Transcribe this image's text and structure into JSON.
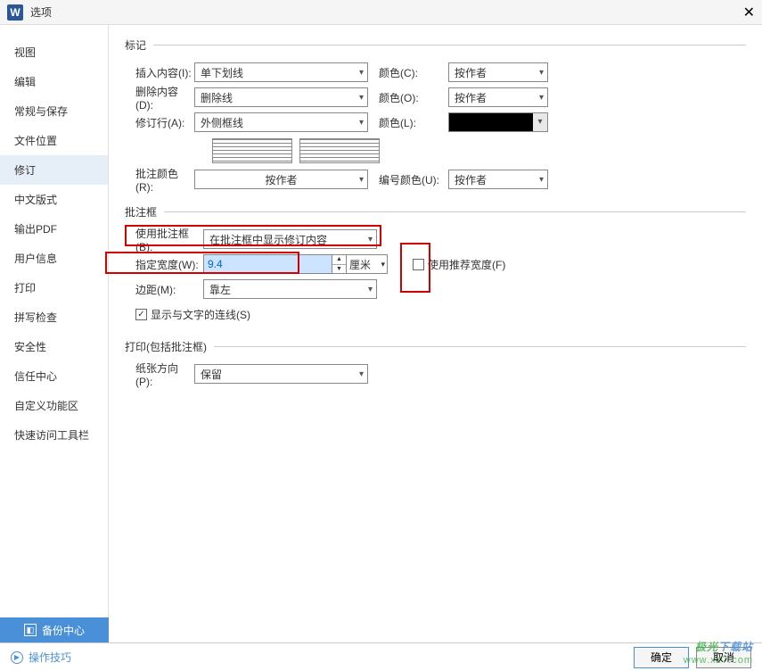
{
  "titlebar": {
    "title": "选项"
  },
  "sidebar": {
    "items": [
      {
        "label": "视图"
      },
      {
        "label": "编辑"
      },
      {
        "label": "常规与保存"
      },
      {
        "label": "文件位置"
      },
      {
        "label": "修订",
        "active": true
      },
      {
        "label": "中文版式"
      },
      {
        "label": "输出PDF"
      },
      {
        "label": "用户信息"
      },
      {
        "label": "打印"
      },
      {
        "label": "拼写检查"
      },
      {
        "label": "安全性"
      },
      {
        "label": "信任中心"
      },
      {
        "label": "自定义功能区"
      },
      {
        "label": "快速访问工具栏"
      }
    ]
  },
  "sections": {
    "marks": {
      "legend": "标记",
      "insert_label": "插入内容(I):",
      "insert_value": "单下划线",
      "insert_color_label": "颜色(C):",
      "insert_color_value": "按作者",
      "delete_label": "删除内容(D):",
      "delete_value": "删除线",
      "delete_color_label": "颜色(O):",
      "delete_color_value": "按作者",
      "revline_label": "修订行(A):",
      "revline_value": "外侧框线",
      "revline_color_label": "颜色(L):",
      "comment_color_label": "批注颜色(R):",
      "comment_color_value": "按作者",
      "number_color_label": "编号颜色(U):",
      "number_color_value": "按作者"
    },
    "balloon": {
      "legend": "批注框",
      "use_label": "使用批注框(B):",
      "use_value": "在批注框中显示修订内容",
      "width_label": "指定宽度(W):",
      "width_value": "9.4",
      "width_unit": "厘米",
      "recommended_label": "使用推荐宽度(F)",
      "recommended_checked": false,
      "margin_label": "边距(M):",
      "margin_value": "靠左",
      "showline_label": "显示与文字的连线(S)",
      "showline_checked": true
    },
    "print": {
      "legend": "打印(包括批注框)",
      "orient_label": "纸张方向(P):",
      "orient_value": "保留"
    }
  },
  "footer": {
    "backup": "备份中心",
    "tips": "操作技巧",
    "ok": "确定",
    "cancel": "取消"
  },
  "watermark": {
    "line1a": "极光",
    "line1b": "下载站",
    "line2": "www.xz7.com"
  }
}
